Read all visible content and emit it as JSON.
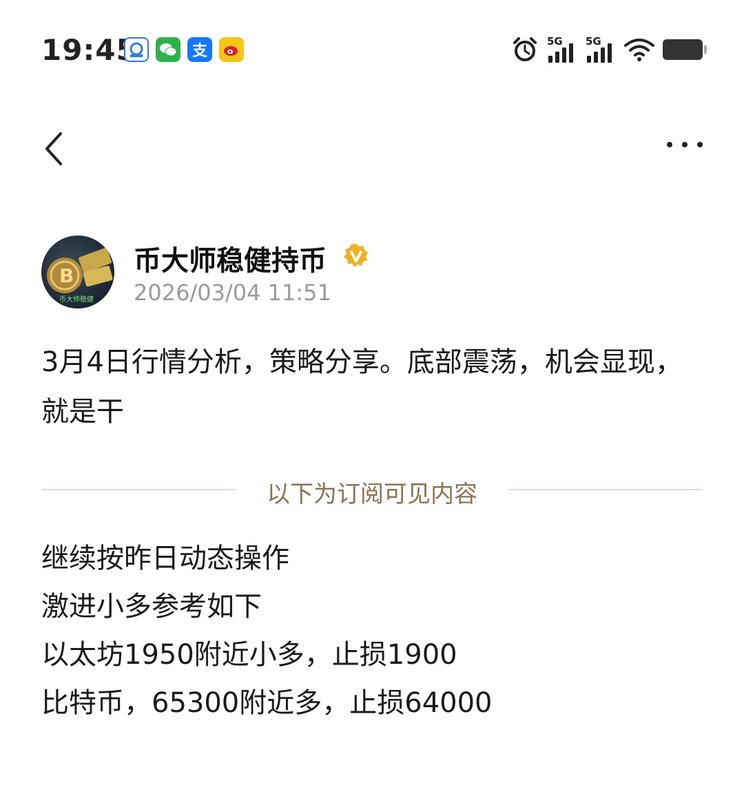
{
  "status_bar": {
    "time": "19:45",
    "app_icons": [
      "app-icon-1",
      "wechat-icon",
      "alipay-icon",
      "weibo-icon"
    ],
    "alipay_glyph": "支",
    "network_1": "5G",
    "network_2": "5G"
  },
  "nav": {
    "back_icon": "chevron-left-icon",
    "more_icon": "more-dots-icon"
  },
  "post": {
    "author_name": "币大师稳健持币",
    "verified": true,
    "timestamp": "2026/03/04 11:51",
    "intro_text": "3月4日行情分析，策略分享。底部震荡，机会显现，就是干",
    "divider_text": "以下为订阅可见内容",
    "lines": [
      "继续按昨日动态操作",
      "激进小多参考如下",
      "以太坊1950附近小多，止损1900",
      "比特币，65300附近多，止损64000"
    ]
  },
  "colors": {
    "divider_text": "#8c7352",
    "divider_line": "#e4dcc8",
    "verified_badge": "#f2b01e",
    "timestamp": "#9a9a9a"
  }
}
